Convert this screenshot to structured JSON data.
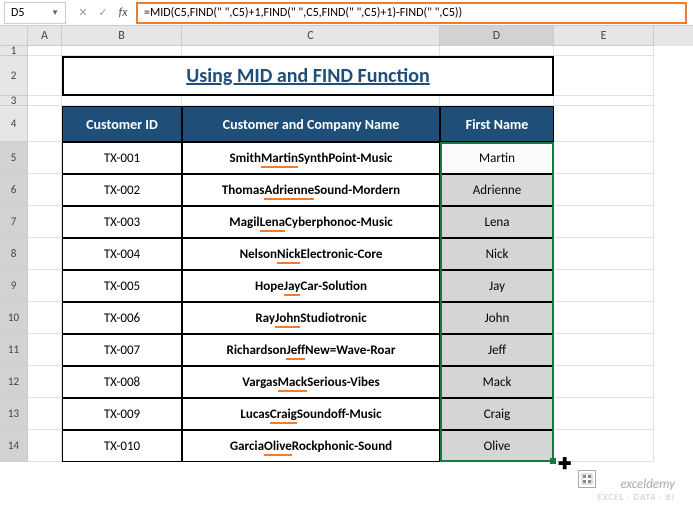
{
  "name_box": "D5",
  "formula": "=MID(C5,FIND(\" \",C5)+1,FIND(\" \",C5,FIND(\" \",C5)+1)-FIND(\" \",C5))",
  "columns": [
    "A",
    "B",
    "C",
    "D",
    "E"
  ],
  "title": "Using MID and FIND Function",
  "headers": {
    "b": "Customer ID",
    "c": "Customer and Company Name",
    "d": "First Name"
  },
  "rows": [
    {
      "num": 5,
      "id": "TX-001",
      "pre": "Smith ",
      "mid": "Martin",
      "post": " SynthPoint-Music",
      "first": "Martin",
      "white": true
    },
    {
      "num": 6,
      "id": "TX-002",
      "pre": "Thomas ",
      "mid": "Adrienne",
      "post": " Sound-Mordern",
      "first": "Adrienne",
      "white": false
    },
    {
      "num": 7,
      "id": "TX-003",
      "pre": "Magil ",
      "mid": "Lena",
      "post": " Cyberphonoc-Music",
      "first": "Lena",
      "white": false
    },
    {
      "num": 8,
      "id": "TX-004",
      "pre": "Nelson ",
      "mid": "Nick",
      "post": " Electronic-Core",
      "first": "Nick",
      "white": false
    },
    {
      "num": 9,
      "id": "TX-005",
      "pre": "Hope ",
      "mid": "Jay",
      "post": " Car-Solution",
      "first": "Jay",
      "white": false
    },
    {
      "num": 10,
      "id": "TX-006",
      "pre": "Ray ",
      "mid": "John",
      "post": " Studiotronic",
      "first": "John",
      "white": false
    },
    {
      "num": 11,
      "id": "TX-007",
      "pre": "Richardson ",
      "mid": "Jeff",
      "post": " New=Wave-Roar",
      "first": "Jeff",
      "white": false
    },
    {
      "num": 12,
      "id": "TX-008",
      "pre": "Vargas ",
      "mid": "Mack",
      "post": " Serious-Vibes",
      "first": "Mack",
      "white": false
    },
    {
      "num": 13,
      "id": "TX-009",
      "pre": "Lucas ",
      "mid": "Craig",
      "post": " Soundoff-Music",
      "first": "Craig",
      "white": false
    },
    {
      "num": 14,
      "id": "TX-010",
      "pre": "Garcia ",
      "mid": "Olive",
      "post": " Rockphonic-Sound",
      "first": "Olive",
      "white": false
    }
  ],
  "watermark": {
    "line1": "exceldemy",
    "line2": "EXCEL · DATA · BI"
  },
  "chart_data": null
}
